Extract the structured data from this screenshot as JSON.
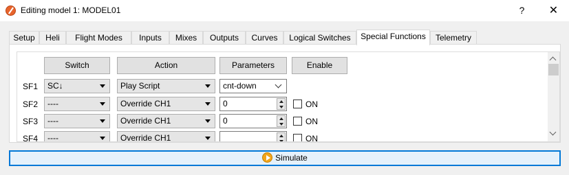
{
  "window": {
    "title": "Editing model 1: MODEL01",
    "help_label": "?",
    "close_label": "✕",
    "icon": "app-logo-icon"
  },
  "tabs": [
    {
      "label": "Setup"
    },
    {
      "label": "Heli"
    },
    {
      "label": "Flight Modes"
    },
    {
      "label": "Inputs"
    },
    {
      "label": "Mixes"
    },
    {
      "label": "Outputs"
    },
    {
      "label": "Curves"
    },
    {
      "label": "Logical Switches"
    },
    {
      "label": "Special Functions",
      "active": true
    },
    {
      "label": "Telemetry"
    }
  ],
  "headers": {
    "switch": "Switch",
    "action": "Action",
    "parameters": "Parameters",
    "enable": "Enable"
  },
  "rows": [
    {
      "label": "SF1",
      "switch": "SC↓",
      "action": "Play Script",
      "param": "cnt-down",
      "param_type": "dropdown"
    },
    {
      "label": "SF2",
      "switch": "----",
      "action": "Override CH1",
      "param": "0",
      "param_type": "spin",
      "enable_label": "ON",
      "enabled": false
    },
    {
      "label": "SF3",
      "switch": "----",
      "action": "Override CH1",
      "param": "0",
      "param_type": "spin",
      "enable_label": "ON",
      "enabled": false
    },
    {
      "label": "SF4",
      "switch": "----",
      "action": "Override CH1",
      "param": "",
      "param_type": "spin",
      "enable_label": "ON",
      "enabled": false
    }
  ],
  "simulate": {
    "label": "Simulate",
    "icon": "play-icon"
  },
  "colors": {
    "accent": "#0078d7",
    "app_icon": "#e8642c",
    "simulate_icon": "#f3a51a"
  }
}
